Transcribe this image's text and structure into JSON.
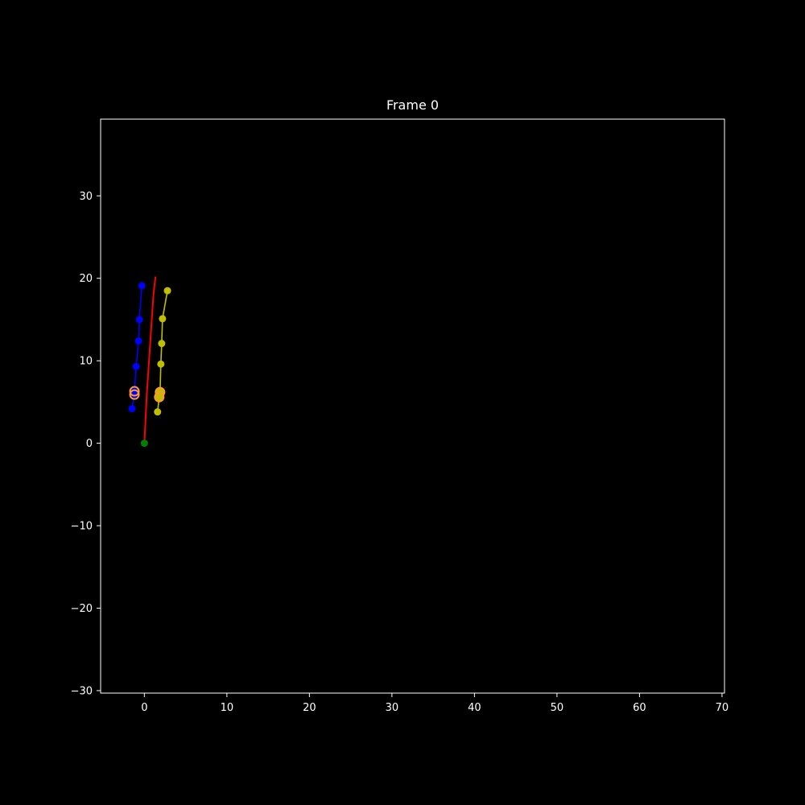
{
  "chart_data": {
    "type": "line",
    "title": "Frame 0",
    "xlabel": "",
    "ylabel": "",
    "xlim": [
      -5.3,
      70.3
    ],
    "ylim": [
      -30.3,
      39.3
    ],
    "x_ticks": [
      0,
      10,
      20,
      30,
      40,
      50,
      60,
      70
    ],
    "y_ticks": [
      -30,
      -20,
      -10,
      0,
      10,
      20,
      30
    ],
    "x_tick_labels": [
      "0",
      "10",
      "20",
      "30",
      "40",
      "50",
      "60",
      "70"
    ],
    "y_tick_labels": [
      "−30",
      "−20",
      "−10",
      "0",
      "10",
      "20",
      "30"
    ],
    "grid": false,
    "background": "#000000",
    "foreground": "#ffffff",
    "series": [
      {
        "color": "#0000ff",
        "style": "line-markers",
        "points": [
          [
            -1.5,
            4.2
          ],
          [
            -1.2,
            5.9
          ],
          [
            -1.2,
            6.3
          ],
          [
            -1.0,
            9.3
          ],
          [
            -0.7,
            12.4
          ],
          [
            -0.6,
            15.0
          ],
          [
            -0.3,
            19.1
          ]
        ]
      },
      {
        "color": "#bfbf00",
        "style": "line-markers",
        "points": [
          [
            1.6,
            3.8
          ],
          [
            1.8,
            5.6
          ],
          [
            1.9,
            6.1
          ],
          [
            2.0,
            9.6
          ],
          [
            2.1,
            12.1
          ],
          [
            2.2,
            15.1
          ],
          [
            2.8,
            18.5
          ]
        ]
      },
      {
        "color": "#ff0000",
        "style": "line",
        "points": [
          [
            0.0,
            0.0
          ],
          [
            0.15,
            3.0
          ],
          [
            0.3,
            6.0
          ],
          [
            0.5,
            9.0
          ],
          [
            0.7,
            12.0
          ],
          [
            0.9,
            15.0
          ],
          [
            1.1,
            18.0
          ],
          [
            1.35,
            20.2
          ]
        ]
      },
      {
        "color": "#008000",
        "style": "markers",
        "points": [
          [
            0.0,
            0.0
          ]
        ]
      }
    ],
    "highlights": [
      {
        "color": "#ff9933",
        "fill": "none",
        "points": [
          [
            -1.2,
            6.3
          ],
          [
            -1.2,
            5.9
          ]
        ]
      },
      {
        "color": "#ff9933",
        "fill": "#bfbf00",
        "points": [
          [
            1.9,
            6.2
          ],
          [
            1.8,
            5.6
          ]
        ]
      }
    ]
  }
}
